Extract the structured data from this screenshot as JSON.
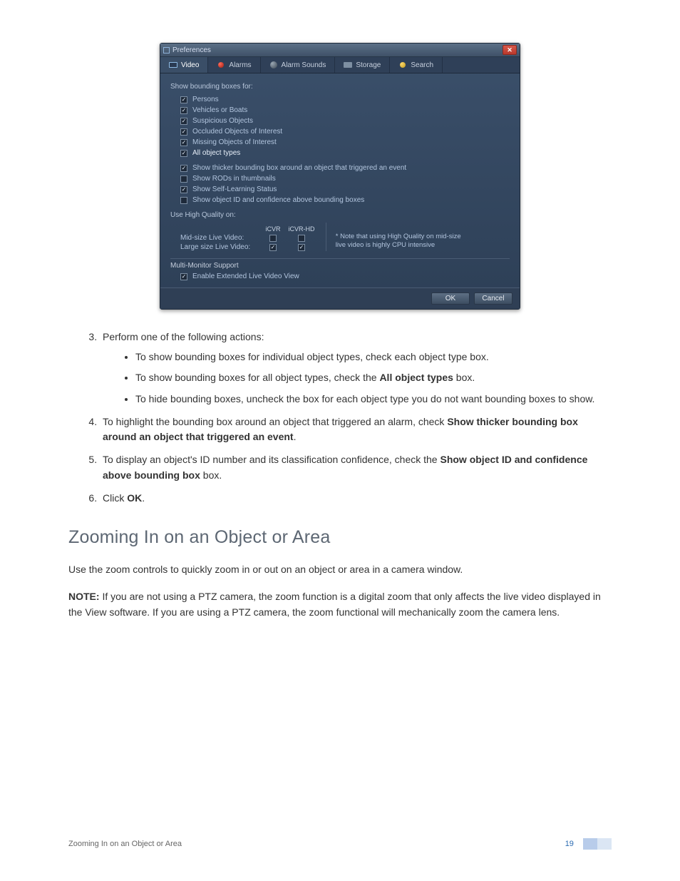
{
  "dialog": {
    "title": "Preferences",
    "tabs": [
      "Video",
      "Alarms",
      "Alarm Sounds",
      "Storage",
      "Search"
    ],
    "section_bounding": "Show bounding boxes for:",
    "bb_types": [
      {
        "label": "Persons",
        "checked": true
      },
      {
        "label": "Vehicles or Boats",
        "checked": true
      },
      {
        "label": "Suspicious Objects",
        "checked": true
      },
      {
        "label": "Occluded Objects of Interest",
        "checked": true
      },
      {
        "label": "Missing Objects of Interest",
        "checked": true
      },
      {
        "label": "All object types",
        "checked": true
      }
    ],
    "opts": [
      {
        "label": "Show thicker bounding box around an object that triggered an event",
        "checked": true
      },
      {
        "label": "Show RODs in thumbnails",
        "checked": false
      },
      {
        "label": "Show Self-Learning Status",
        "checked": true
      },
      {
        "label": "Show object ID and confidence above bounding boxes",
        "checked": false
      }
    ],
    "quality_section": "Use High Quality on:",
    "q_cols": [
      "iCVR",
      "iCVR-HD"
    ],
    "q_rows": [
      {
        "label": "Mid-size Live Video:",
        "c0": false,
        "c1": false
      },
      {
        "label": "Large size Live Video:",
        "c0": true,
        "c1": true
      }
    ],
    "quality_note": "* Note that using High Quality on mid-size live video is highly CPU intensive",
    "mm_section": "Multi-Monitor Support",
    "mm_check": {
      "label": "Enable Extended Live Video View",
      "checked": true
    },
    "ok": "OK",
    "cancel": "Cancel"
  },
  "doc": {
    "step3": "Perform one of the following actions:",
    "bullets": [
      "To show bounding boxes for individual object types, check each object type box.",
      "To show bounding boxes for all object types, check the ",
      "All object types",
      " box.",
      "To hide bounding boxes, uncheck the box for each object type you do not want bounding boxes to show."
    ],
    "step4a": "To highlight the bounding box around an object that triggered an alarm, check ",
    "step4b": "Show thicker bounding box around an object that triggered an event",
    "step4c": ".",
    "step5a": "To display an object's ID number and its classification confidence, check the ",
    "step5b": "Show object ID and confidence above bounding box",
    "step5c": " box.",
    "step6a": "Click ",
    "step6b": "OK",
    "step6c": ".",
    "h2": "Zooming In on an Object or Area",
    "p1": "Use the zoom controls to quickly zoom in or out on an object or area in a camera window.",
    "note_lead": "NOTE:",
    "note_body": " If you are not using a PTZ camera, the zoom function is a digital zoom that only affects the live video displayed in the View software. If you are using a PTZ camera, the zoom functional will mechanically zoom the camera lens."
  },
  "footer": {
    "left": "Zooming In on an Object or Area",
    "page": "19"
  }
}
